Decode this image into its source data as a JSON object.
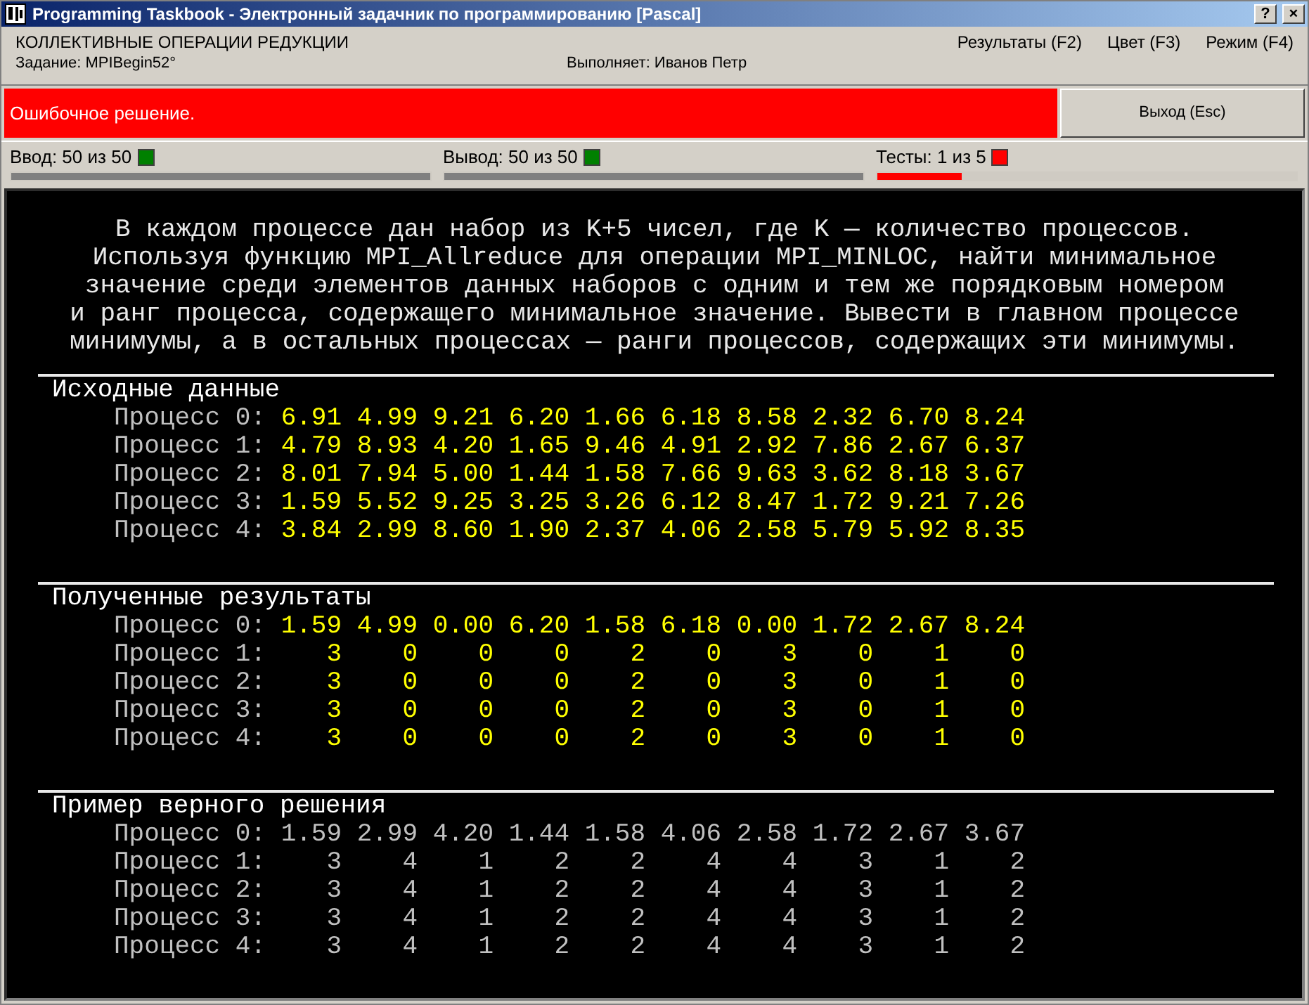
{
  "window": {
    "title": "Programming Taskbook - Электронный задачник по программированию [Pascal]",
    "buttons": [
      "?",
      "×"
    ]
  },
  "header": {
    "topic": "КОЛЛЕКТИВНЫЕ ОПЕРАЦИИ РЕДУКЦИИ",
    "task": "Задание: MPIBegin52°",
    "author": "Выполняет: Иванов Петр",
    "menu": [
      {
        "label": "Результаты (F2)"
      },
      {
        "label": "Цвет (F3)"
      },
      {
        "label": "Режим (F4)"
      }
    ]
  },
  "result": {
    "message": "Ошибочное решение.",
    "exit_button": "Выход (Esc)"
  },
  "status": [
    {
      "label": "Ввод: 50 из 50",
      "color": "#008000",
      "level": 1
    },
    {
      "label": "Вывод: 50 из 50",
      "color": "#008000",
      "level": 1
    },
    {
      "label": "Тесты: 1 из 5",
      "color": "#ff0000",
      "level": 0.2
    }
  ],
  "description": [
    "В каждом процессе дан набор из K+5 чисел, где K — количество процессов.",
    "Используя функцию MPI_Allreduce для операции MPI_MINLOC, найти минимальное",
    "значение среди элементов данных наборов с одним и тем же порядковым номером",
    "и ранг процесса, содержащего минимальное значение. Вывести в главном процессе",
    "минимумы, а в остальных процессах — ранги процессов, содержащих эти минимумы."
  ],
  "sections": [
    {
      "kind": "input",
      "title": "Исходные данные",
      "rows": [
        {
          "label": "Процесс 0:",
          "values": [
            "6.91",
            "4.99",
            "9.21",
            "6.20",
            "1.66",
            "6.18",
            "8.58",
            "2.32",
            "6.70",
            "8.24"
          ]
        },
        {
          "label": "Процесс 1:",
          "values": [
            "4.79",
            "8.93",
            "4.20",
            "1.65",
            "9.46",
            "4.91",
            "2.92",
            "7.86",
            "2.67",
            "6.37"
          ]
        },
        {
          "label": "Процесс 2:",
          "values": [
            "8.01",
            "7.94",
            "5.00",
            "1.44",
            "1.58",
            "7.66",
            "9.63",
            "3.62",
            "8.18",
            "3.67"
          ]
        },
        {
          "label": "Процесс 3:",
          "values": [
            "1.59",
            "5.52",
            "9.25",
            "3.25",
            "3.26",
            "6.12",
            "8.47",
            "1.72",
            "9.21",
            "7.26"
          ]
        },
        {
          "label": "Процесс 4:",
          "values": [
            "3.84",
            "2.99",
            "8.60",
            "1.90",
            "2.37",
            "4.06",
            "2.58",
            "5.79",
            "5.92",
            "8.35"
          ]
        }
      ]
    },
    {
      "kind": "result",
      "title": "Полученные результаты",
      "rows": [
        {
          "label": "Процесс 0:",
          "values": [
            "1.59",
            "4.99",
            "0.00",
            "6.20",
            "1.58",
            "6.18",
            "0.00",
            "1.72",
            "2.67",
            "8.24"
          ]
        },
        {
          "label": "Процесс 1:",
          "values": [
            "3",
            "0",
            "0",
            "0",
            "2",
            "0",
            "3",
            "0",
            "1",
            "0"
          ]
        },
        {
          "label": "Процесс 2:",
          "values": [
            "3",
            "0",
            "0",
            "0",
            "2",
            "0",
            "3",
            "0",
            "1",
            "0"
          ]
        },
        {
          "label": "Процесс 3:",
          "values": [
            "3",
            "0",
            "0",
            "0",
            "2",
            "0",
            "3",
            "0",
            "1",
            "0"
          ]
        },
        {
          "label": "Процесс 4:",
          "values": [
            "3",
            "0",
            "0",
            "0",
            "2",
            "0",
            "3",
            "0",
            "1",
            "0"
          ]
        }
      ]
    },
    {
      "kind": "example",
      "title": "Пример верного решения",
      "rows": [
        {
          "label": "Процесс 0:",
          "values": [
            "1.59",
            "2.99",
            "4.20",
            "1.44",
            "1.58",
            "4.06",
            "2.58",
            "1.72",
            "2.67",
            "3.67"
          ]
        },
        {
          "label": "Процесс 1:",
          "values": [
            "3",
            "4",
            "1",
            "2",
            "2",
            "4",
            "4",
            "3",
            "1",
            "2"
          ]
        },
        {
          "label": "Процесс 2:",
          "values": [
            "3",
            "4",
            "1",
            "2",
            "2",
            "4",
            "4",
            "3",
            "1",
            "2"
          ]
        },
        {
          "label": "Процесс 3:",
          "values": [
            "3",
            "4",
            "1",
            "2",
            "2",
            "4",
            "4",
            "3",
            "1",
            "2"
          ]
        },
        {
          "label": "Процесс 4:",
          "values": [
            "3",
            "4",
            "1",
            "2",
            "2",
            "4",
            "4",
            "3",
            "1",
            "2"
          ]
        }
      ]
    }
  ]
}
